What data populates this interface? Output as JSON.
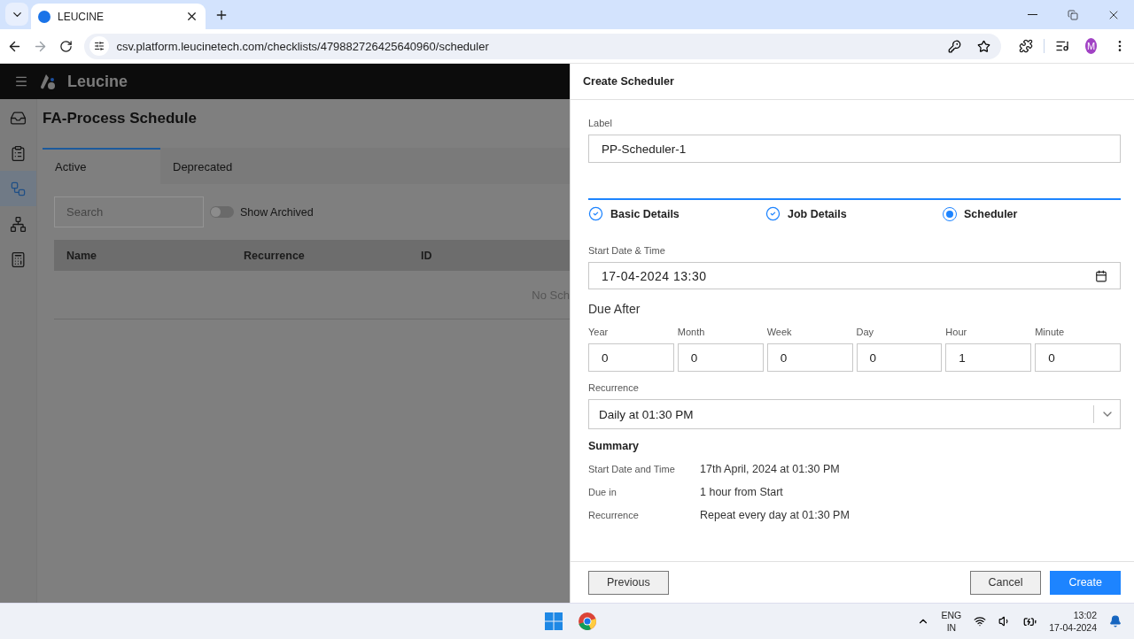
{
  "browser": {
    "tabs": [
      {
        "title": "LEUCINE",
        "selected": true
      }
    ],
    "url": "csv.platform.leucinetech.com/checklists/479882726425640960/scheduler",
    "avatar_initial": "M"
  },
  "app": {
    "brand": "Leucine",
    "nav_items": [
      {
        "kind": "inbox",
        "selected": false
      },
      {
        "kind": "checklist",
        "selected": false
      },
      {
        "kind": "flow",
        "selected": true
      },
      {
        "kind": "hierarchy",
        "selected": false
      },
      {
        "kind": "report",
        "selected": false
      }
    ]
  },
  "page": {
    "title": "FA-Process Schedule",
    "tabs": [
      {
        "label": "Active",
        "selected": true
      },
      {
        "label": "Deprecated",
        "selected": false
      }
    ],
    "search": {
      "placeholder": "Search"
    },
    "show_archived": {
      "label": "Show Archived",
      "on": false
    },
    "table": {
      "columns": [
        "Name",
        "Recurrence",
        "ID"
      ],
      "empty_text": "No Sch"
    }
  },
  "drawer": {
    "title": "Create Scheduler",
    "label_field": {
      "label": "Label",
      "value": "PP-Scheduler-1"
    },
    "steps": [
      {
        "label": "Basic Details",
        "kind": "done"
      },
      {
        "label": "Job Details",
        "kind": "done"
      },
      {
        "label": "Scheduler",
        "kind": "current"
      }
    ],
    "start": {
      "label": "Start Date & Time",
      "value": "17-04-2024 13:30"
    },
    "due_after": {
      "title": "Due After",
      "fields": [
        {
          "label": "Year",
          "value": "0"
        },
        {
          "label": "Month",
          "value": "0"
        },
        {
          "label": "Week",
          "value": "0"
        },
        {
          "label": "Day",
          "value": "0"
        },
        {
          "label": "Hour",
          "value": "1"
        },
        {
          "label": "Minute",
          "value": "0"
        }
      ]
    },
    "recurrence": {
      "label": "Recurrence",
      "value": "Daily at 01:30 PM"
    },
    "summary": {
      "title": "Summary",
      "rows": [
        {
          "label": "Start Date and Time",
          "value": "17th April, 2024 at 01:30 PM"
        },
        {
          "label": "Due in",
          "value": "1 hour from Start"
        },
        {
          "label": "Recurrence",
          "value": "Repeat every day at 01:30 PM"
        }
      ]
    },
    "buttons": {
      "previous": "Previous",
      "cancel": "Cancel",
      "create": "Create"
    }
  },
  "taskbar": {
    "language": [
      "ENG",
      "IN"
    ],
    "time": "13:02",
    "date": "17-04-2024"
  }
}
